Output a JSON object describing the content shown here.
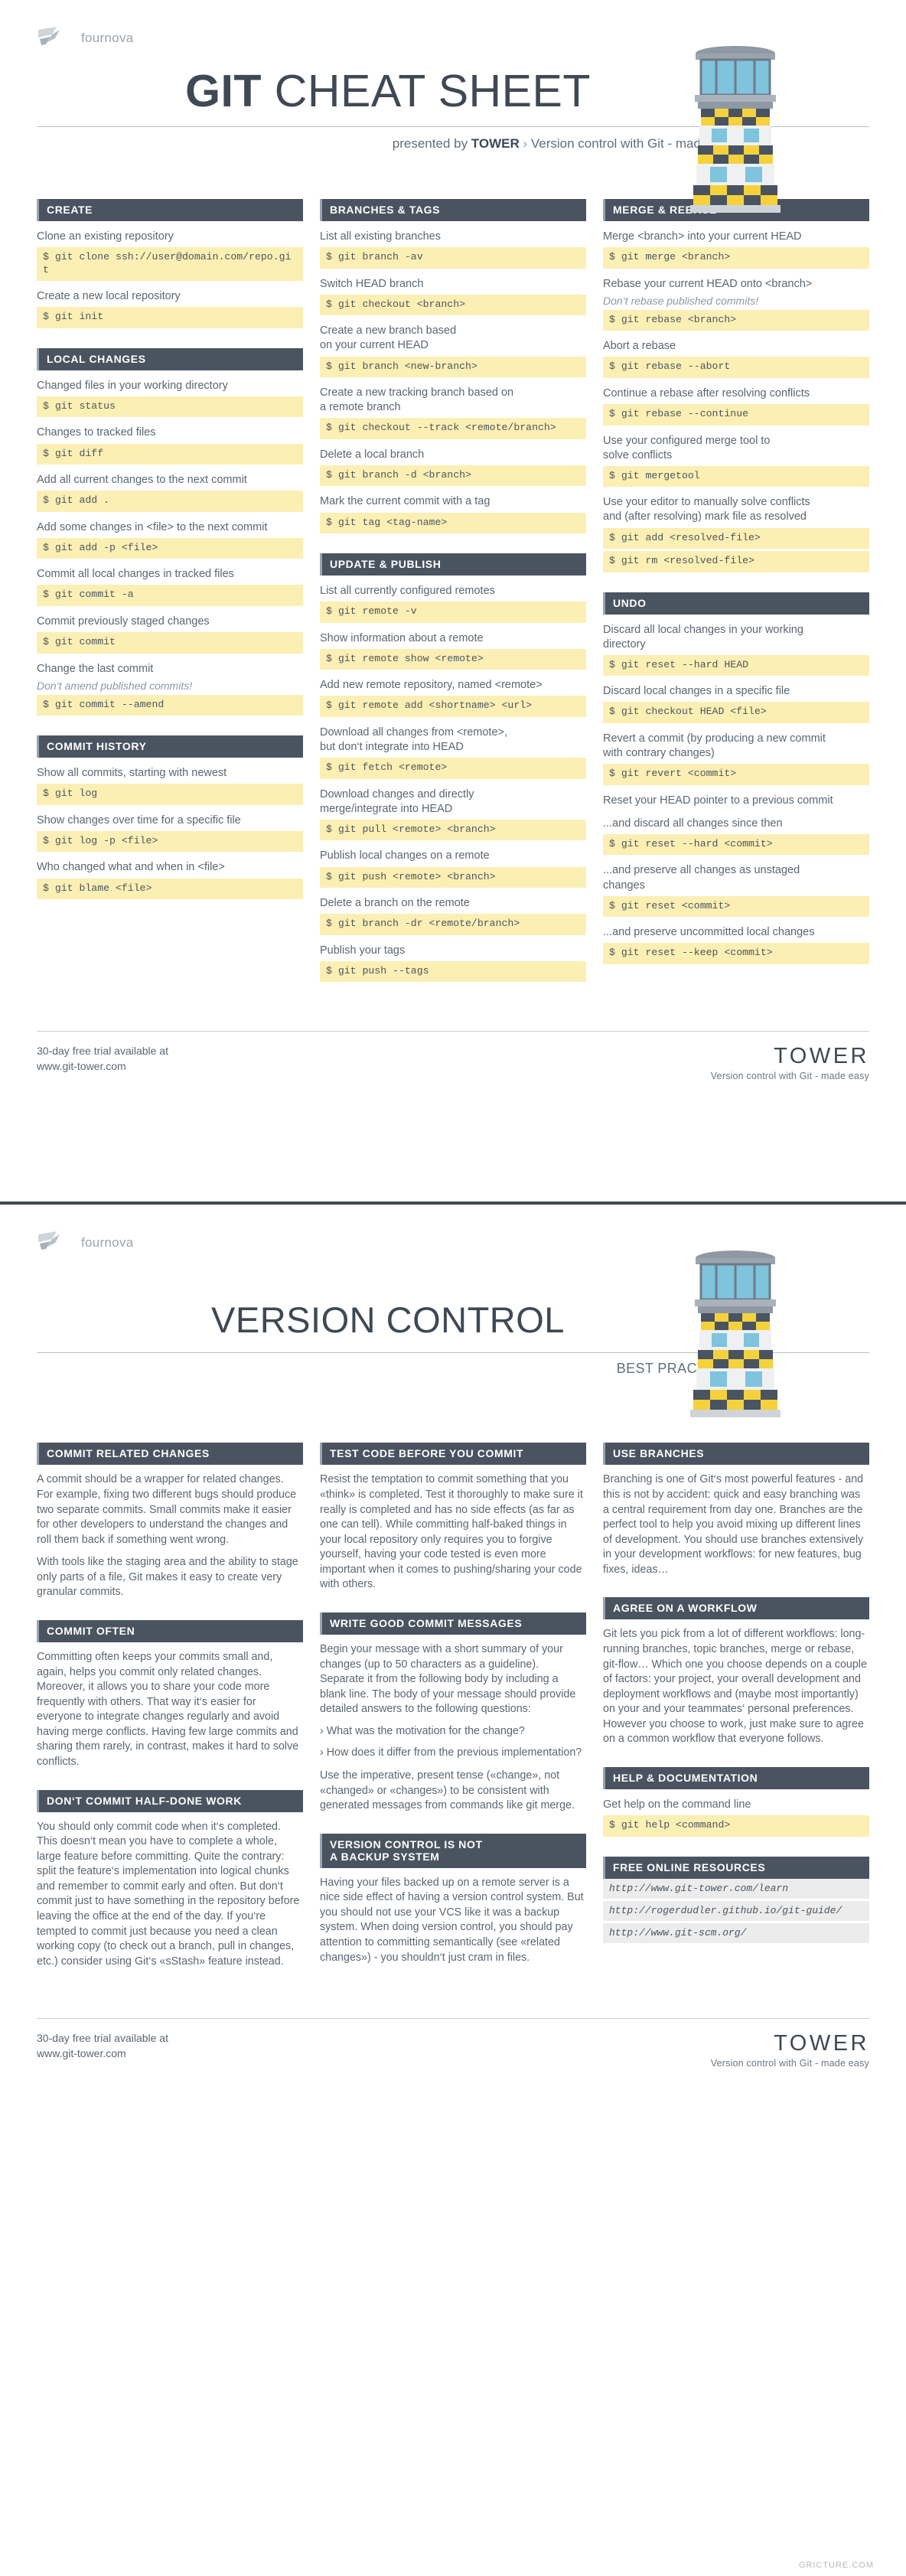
{
  "brand": {
    "name": "fournova",
    "logo_icon": "fournova-chevron-logo"
  },
  "page1": {
    "title_bold": "GIT",
    "title_rest": " CHEAT SHEET",
    "subtitle_prefix": "presented by ",
    "subtitle_brand": "TOWER",
    "subtitle_chevron": " › ",
    "subtitle_tail": "Version control with Git - made easy",
    "tower_icon": "lighthouse-tower-illustration",
    "columns": [
      {
        "sections": [
          {
            "title": "CREATE",
            "items": [
              {
                "desc": "Clone an existing repository",
                "cmds": [
                  "$ git clone ssh://user@domain.com/repo.git"
                ]
              },
              {
                "desc": "Create a new local repository",
                "cmds": [
                  "$ git init"
                ]
              }
            ]
          },
          {
            "title": "LOCAL CHANGES",
            "items": [
              {
                "desc": "Changed files in your working directory",
                "cmds": [
                  "$ git status"
                ]
              },
              {
                "desc": "Changes to tracked files",
                "cmds": [
                  "$ git diff"
                ]
              },
              {
                "desc": "Add all current changes to the next commit",
                "cmds": [
                  "$ git add ."
                ]
              },
              {
                "desc": "Add some changes in <file> to the next commit",
                "cmds": [
                  "$ git add -p <file>"
                ]
              },
              {
                "desc": "Commit all local changes in tracked files",
                "cmds": [
                  "$ git commit -a"
                ]
              },
              {
                "desc": "Commit previously staged changes",
                "cmds": [
                  "$ git commit"
                ]
              },
              {
                "desc": "Change the last commit",
                "note": "Don‘t amend published commits!",
                "cmds": [
                  "$ git commit --amend"
                ]
              }
            ]
          },
          {
            "title": "COMMIT HISTORY",
            "items": [
              {
                "desc": "Show all commits, starting with newest",
                "cmds": [
                  "$ git log"
                ]
              },
              {
                "desc": "Show changes over time for a specific file",
                "cmds": [
                  "$ git log -p <file>"
                ]
              },
              {
                "desc": "Who changed what and when in <file>",
                "cmds": [
                  "$ git blame <file>"
                ]
              }
            ]
          }
        ]
      },
      {
        "sections": [
          {
            "title": "BRANCHES & TAGS",
            "items": [
              {
                "desc": "List all existing branches",
                "cmds": [
                  "$ git branch -av"
                ]
              },
              {
                "desc": "Switch HEAD branch",
                "cmds": [
                  "$ git checkout <branch>"
                ]
              },
              {
                "desc": "Create a new branch based\non your current HEAD",
                "cmds": [
                  "$ git branch <new-branch>"
                ]
              },
              {
                "desc": "Create a new tracking branch based on\na remote branch",
                "cmds": [
                  "$ git checkout --track <remote/branch>"
                ]
              },
              {
                "desc": "Delete a local branch",
                "cmds": [
                  "$ git branch -d <branch>"
                ]
              },
              {
                "desc": "Mark the current commit with a tag",
                "cmds": [
                  "$ git tag <tag-name>"
                ]
              }
            ]
          },
          {
            "title": "UPDATE & PUBLISH",
            "items": [
              {
                "desc": "List all currently configured remotes",
                "cmds": [
                  "$ git remote -v"
                ]
              },
              {
                "desc": "Show information about a remote",
                "cmds": [
                  "$ git remote show <remote>"
                ]
              },
              {
                "desc": "Add new remote repository, named <remote>",
                "cmds": [
                  "$ git remote add <shortname> <url>"
                ]
              },
              {
                "desc": "Download all changes from <remote>,\nbut don‘t integrate into HEAD",
                "cmds": [
                  "$ git fetch <remote>"
                ]
              },
              {
                "desc": "Download changes and directly\nmerge/integrate into  HEAD",
                "cmds": [
                  "$ git pull <remote> <branch>"
                ]
              },
              {
                "desc": "Publish local changes on a remote",
                "cmds": [
                  "$ git push <remote> <branch>"
                ]
              },
              {
                "desc": "Delete a branch on the remote",
                "cmds": [
                  "$ git branch -dr <remote/branch>"
                ]
              },
              {
                "desc": "Publish your tags",
                "cmds": [
                  "$ git push --tags"
                ]
              }
            ]
          }
        ]
      },
      {
        "sections": [
          {
            "title": "MERGE & REBASE",
            "items": [
              {
                "desc": "Merge <branch> into your current HEAD",
                "cmds": [
                  "$ git merge <branch>"
                ]
              },
              {
                "desc": "Rebase your current HEAD onto <branch>",
                "note": "Don‘t rebase published commits!",
                "cmds": [
                  "$ git rebase <branch>"
                ]
              },
              {
                "desc": "Abort a rebase",
                "cmds": [
                  "$ git rebase --abort"
                ]
              },
              {
                "desc": "Continue a rebase after resolving conflicts",
                "cmds": [
                  "$ git rebase --continue"
                ]
              },
              {
                "desc": "Use your configured merge tool to\nsolve conflicts",
                "cmds": [
                  "$ git mergetool"
                ]
              },
              {
                "desc": "Use your editor to manually solve conflicts\nand (after resolving) mark file as resolved",
                "cmds": [
                  "$ git add <resolved-file>",
                  "$ git rm <resolved-file>"
                ]
              }
            ]
          },
          {
            "title": "UNDO",
            "items": [
              {
                "desc": "Discard all local changes in your working\ndirectory",
                "cmds": [
                  "$ git reset --hard HEAD"
                ]
              },
              {
                "desc": "Discard local changes in a specific file",
                "cmds": [
                  "$ git checkout HEAD <file>"
                ]
              },
              {
                "desc": "Revert a commit (by producing a new commit\nwith contrary changes)",
                "cmds": [
                  "$ git revert <commit>"
                ]
              },
              {
                "desc": "Reset your HEAD pointer to a previous commit",
                "cmds": []
              },
              {
                "desc": "...and discard all changes since then",
                "cmds": [
                  "$ git reset --hard <commit>"
                ]
              },
              {
                "desc": "...and preserve all changes as unstaged\nchanges",
                "cmds": [
                  "$ git reset <commit>"
                ]
              },
              {
                "desc": "...and preserve uncommitted local changes",
                "cmds": [
                  "$ git reset --keep <commit>"
                ]
              }
            ]
          }
        ]
      }
    ],
    "footer": {
      "left_line1": "30-day free trial available at",
      "left_line2": "www.git-tower.com",
      "tower": "TOWER",
      "tagline": "Version control with Git - made easy"
    }
  },
  "page2": {
    "title": "VERSION CONTROL",
    "subtitle": "BEST PRACTICES",
    "tower_icon": "lighthouse-tower-illustration",
    "columns": [
      {
        "sections": [
          {
            "title": "COMMIT RELATED CHANGES",
            "paragraphs": [
              "A commit should be a wrapper for related changes. For example, fixing two different bugs should produce two separate commits. Small commits make it easier for other developers to understand the changes and roll them back if something went wrong.",
              "With tools like the staging area and the ability to stage only parts of a file, Git makes it easy to create very granular commits."
            ]
          },
          {
            "title": "COMMIT OFTEN",
            "paragraphs": [
              "Committing often keeps your commits small and, again, helps you commit only related changes. Moreover, it allows you to share your code more frequently with others. That way it‘s easier for everyone to integrate changes regularly and avoid having merge conflicts. Having few large commits and sharing them rarely, in contrast, makes it hard to solve conflicts."
            ]
          },
          {
            "title": "DON‘T COMMIT HALF-DONE WORK",
            "paragraphs": [
              "You should only commit code when it‘s completed. This doesn‘t mean you have to complete a whole, large feature before committing. Quite the contrary: split the feature‘s implementation into logical chunks and remember to commit early and often. But don‘t commit just to have something in the repository before leaving the office at the end of the day. If you‘re tempted to commit just because you need a clean working copy (to check out a branch, pull in changes, etc.) consider using Git‘s «sStash» feature instead."
            ]
          }
        ]
      },
      {
        "sections": [
          {
            "title": "TEST CODE BEFORE YOU COMMIT",
            "paragraphs": [
              "Resist the temptation to commit something that you «think» is completed. Test it thoroughly to make sure it really is completed and has no side effects (as far as one can tell). While committing half-baked things in your local repository only requires you to forgive yourself, having your code tested is even more important when it comes to pushing/sharing your code with others."
            ]
          },
          {
            "title": "WRITE GOOD COMMIT MESSAGES",
            "paragraphs": [
              "Begin your message with a short summary of your changes (up to 50 characters as a guideline). Separate it from the following body by including a blank line. The body of your message should provide detailed answers to the following questions:"
            ],
            "bullets": [
              "› What was the motivation for the change?",
              "› How does it differ from the previous implementation?"
            ],
            "paragraphs_after": [
              "Use the imperative, present tense («change», not «changed» or «changes») to be consistent with generated messages from commands like git merge."
            ]
          },
          {
            "title": "VERSION CONTROL IS NOT\nA BACKUP SYSTEM",
            "paragraphs": [
              "Having your files backed up on a remote server is a nice side effect of having a version control system. But you should not use your VCS like it was a backup system. When doing version control, you should pay attention to committing semantically (see «related changes») - you shouldn‘t just cram in files."
            ]
          }
        ]
      },
      {
        "sections": [
          {
            "title": "USE BRANCHES",
            "paragraphs": [
              "Branching is one of Git‘s most powerful features - and this is not by accident: quick and easy branching was a central requirement from day one. Branches are the perfect tool to help you avoid mixing up different lines of development. You should use branches extensively in your development workflows: for new features, bug fixes, ideas…"
            ]
          },
          {
            "title": "AGREE ON A WORKFLOW",
            "paragraphs": [
              "Git lets you pick from a lot of different workflows: long-running branches, topic branches, merge or rebase, git-flow… Which one you choose depends on a couple of factors: your project, your overall development and deployment workflows and (maybe most importantly) on your and your teammates‘ personal preferences. However you choose to work, just make sure to agree on a common workflow that everyone follows."
            ]
          },
          {
            "title": "HELP & DOCUMENTATION",
            "items": [
              {
                "desc": "Get help on the command line",
                "cmds": [
                  "$ git help <command>"
                ]
              }
            ]
          },
          {
            "title": "FREE ONLINE RESOURCES",
            "links": [
              "http://www.git-tower.com/learn",
              "http://rogerdudler.github.io/git-guide/",
              "http://www.git-scm.org/"
            ]
          }
        ]
      }
    ],
    "footer": {
      "left_line1": "30-day free trial available at",
      "left_line2": "www.git-tower.com",
      "tower": "TOWER",
      "tagline": "Version control with Git - made easy"
    },
    "watermark": "GRICTURE.COM"
  }
}
